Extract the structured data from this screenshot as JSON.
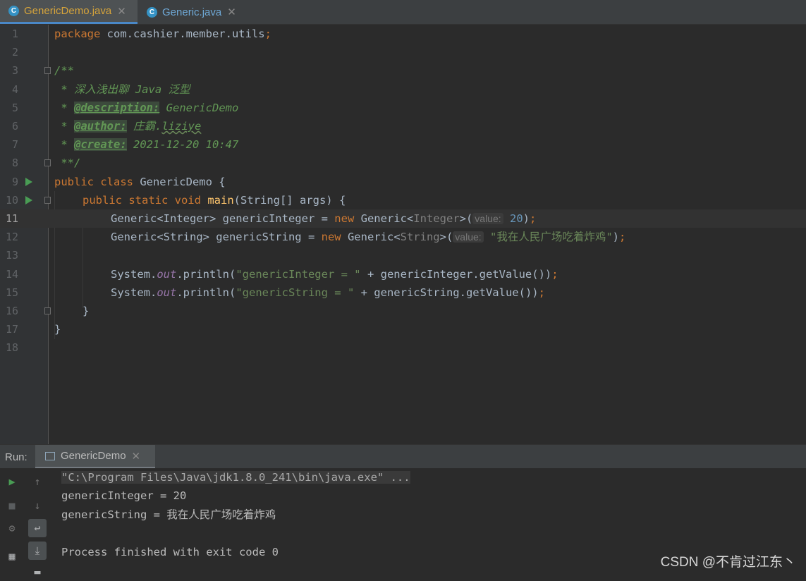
{
  "tabs": [
    {
      "label": "GenericDemo.java",
      "active": true
    },
    {
      "label": "Generic.java",
      "active": false
    }
  ],
  "editor": {
    "current_line": 11,
    "line_numbers": [
      "1",
      "2",
      "3",
      "4",
      "5",
      "6",
      "7",
      "8",
      "9",
      "10",
      "11",
      "12",
      "13",
      "14",
      "15",
      "16",
      "17",
      "18"
    ],
    "code": {
      "l1_kw": "package",
      "l1_rest": " com.cashier.member.utils",
      "l1_semi": ";",
      "l3": "/**",
      "l4": " * 深入浅出聊 Java 泛型",
      "l5_star": " * ",
      "l5_tag": "@description:",
      "l5_val": " GenericDemo",
      "l6_star": " * ",
      "l6_tag": "@author:",
      "l6_val": " 庄霸.",
      "l6_val2": "liziye",
      "l7_star": " * ",
      "l7_tag": "@create:",
      "l7_val": " 2021-12-20 10:47",
      "l8": " **/",
      "l9_kw": "public class",
      "l9_rest": " GenericDemo {",
      "l10_kw": "public static void",
      "l10_fn": "main",
      "l10_rest": "(String[] args) {",
      "l11_a": "Generic<Integer> genericInteger = ",
      "l11_new": "new",
      "l11_b": " Generic<",
      "l11_gen": "Integer",
      "l11_c": ">(",
      "l11_hint": "value:",
      "l11_num": "20",
      "l11_d": ")",
      "l11_semi": ";",
      "l12_a": "Generic<String> genericString = ",
      "l12_new": "new",
      "l12_b": " Generic<",
      "l12_gen": "String",
      "l12_c": ">(",
      "l12_hint": "value:",
      "l12_str": "\"我在人民广场吃着炸鸡\"",
      "l12_d": ")",
      "l12_semi": ";",
      "l14_a": "System.",
      "l14_out": "out",
      "l14_b": ".println(",
      "l14_str": "\"genericInteger = \"",
      "l14_c": " + genericInteger.getValue())",
      "l14_semi": ";",
      "l15_a": "System.",
      "l15_out": "out",
      "l15_b": ".println(",
      "l15_str": "\"genericString = \"",
      "l15_c": " + genericString.getValue())",
      "l15_semi": ";",
      "l16": "}",
      "l17": "}"
    }
  },
  "run": {
    "label": "Run:",
    "tab": "GenericDemo",
    "console": [
      "\"C:\\Program Files\\Java\\jdk1.8.0_241\\bin\\java.exe\" ...",
      "genericInteger = 20",
      "genericString = 我在人民广场吃着炸鸡",
      "",
      "Process finished with exit code 0"
    ]
  },
  "watermark": "CSDN @不肯过江东丶",
  "colors": {
    "keyword": "#cc7832",
    "comment": "#629755",
    "string": "#6a8759",
    "number": "#6897bb",
    "function": "#ffc66d",
    "static": "#9876aa"
  }
}
